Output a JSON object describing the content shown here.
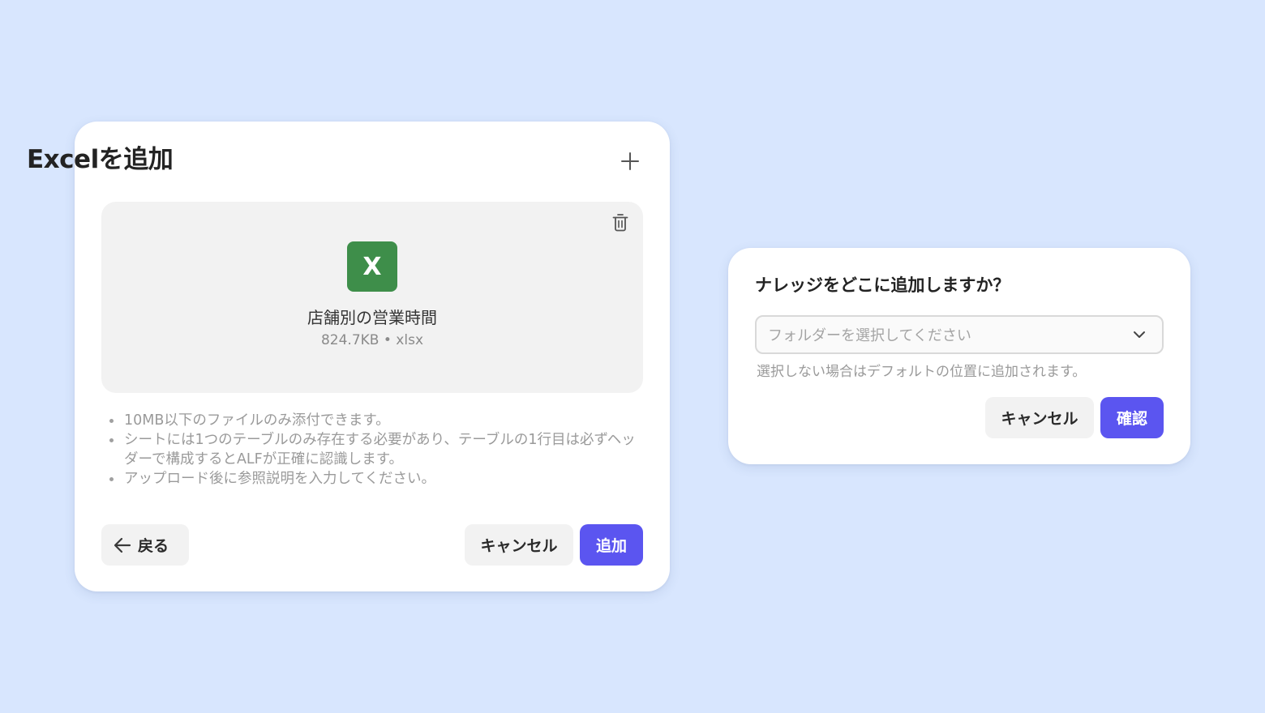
{
  "excel_dialog": {
    "title": "Excelを追加",
    "close_icon": "plus-icon",
    "file": {
      "icon_letter": "X",
      "icon_color": "#3e8e4a",
      "name": "店舗別の営業時間",
      "meta": "824.7KB • xlsx",
      "delete_icon": "trash-icon"
    },
    "notes": [
      "10MB以下のファイルのみ添付できます。",
      "シートには1つのテーブルのみ存在する必要があり、テーブルの1行目は必ずヘッダーで構成するとALFが正確に認識します。",
      "アップロード後に参照説明を入力してください。"
    ],
    "back_label": "戻る",
    "back_icon": "arrow-left-icon",
    "cancel_label": "キャンセル",
    "add_label": "追加"
  },
  "folder_dialog": {
    "title": "ナレッジをどこに追加しますか？",
    "select_placeholder": "フォルダーを選択してください",
    "select_icon": "chevron-down-icon",
    "hint": "選択しない場合はデフォルトの位置に追加されます。",
    "cancel_label": "キャンセル",
    "confirm_label": "確認"
  },
  "colors": {
    "background": "#d8e6fe",
    "primary": "#5b55f0",
    "excel_green": "#3e8e4a",
    "secondary_button": "#f2f2f2"
  }
}
